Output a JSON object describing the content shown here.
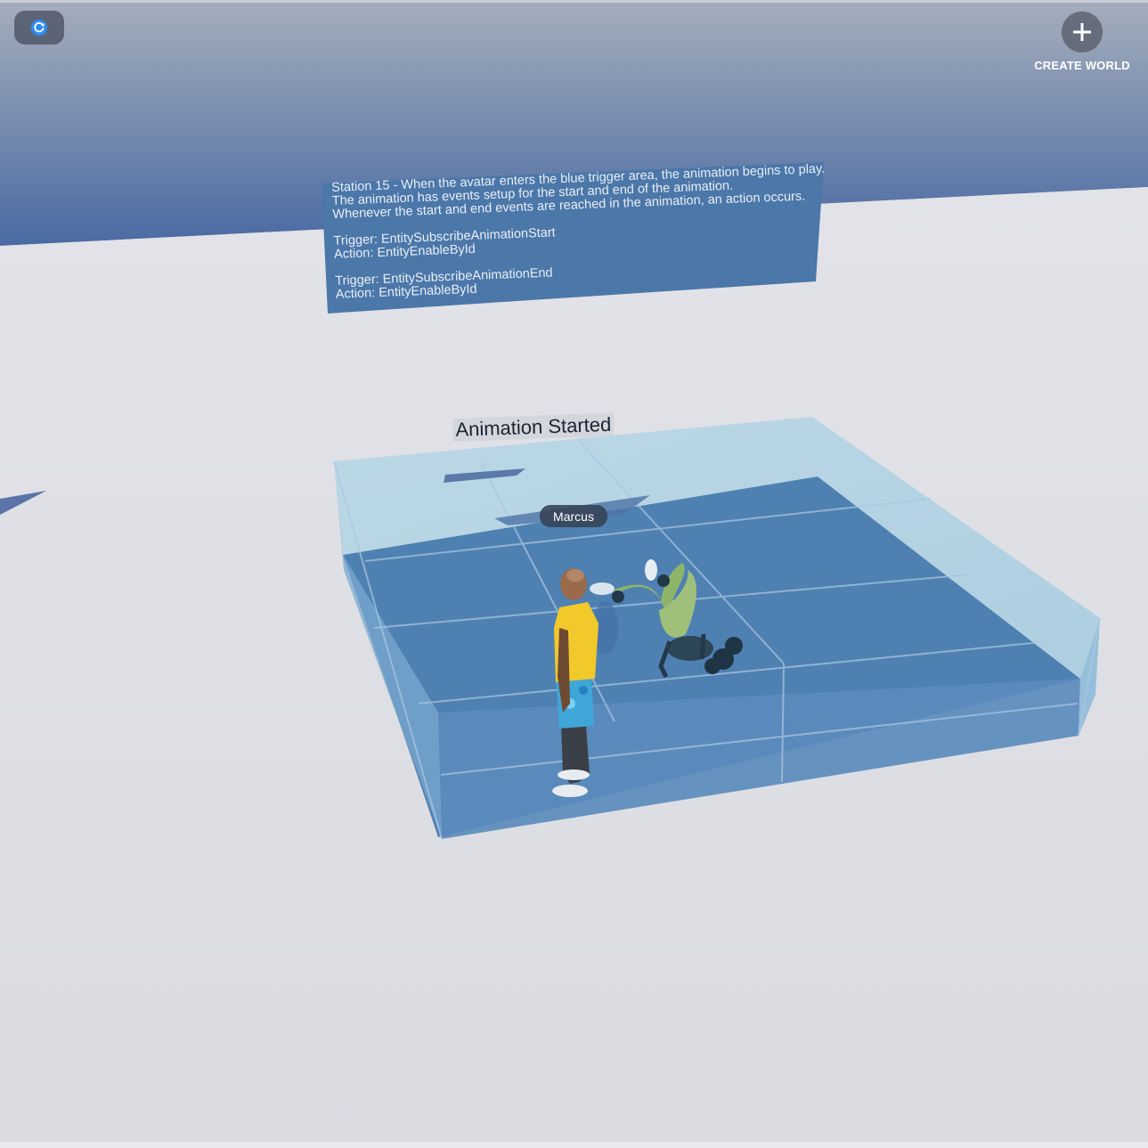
{
  "toolbar": {
    "refresh_icon": "refresh-icon",
    "create_world_label": "CREATE WORLD",
    "create_world_icon": "plus-icon"
  },
  "info_panel": {
    "lines": [
      "Station 15 - When the avatar enters the blue trigger area, the animation begins to play.",
      "The animation has events setup for the start and end of the animation.",
      "Whenever the start and end events are reached in the animation, an action occurs."
    ],
    "block1_trigger": "Trigger: EntitySubscribeAnimationStart",
    "block1_action": "Action: EntityEnableById",
    "block2_trigger": "Trigger: EntitySubscribeAnimationEnd",
    "block2_action": "Action: EntityEnableById"
  },
  "scene": {
    "animation_status": "Animation Started",
    "avatar_name": "Marcus"
  },
  "colors": {
    "sky_top": "#a3acbb",
    "sky_bottom": "#4f6fa5",
    "floor": "#dcdde3",
    "panel_blue": "#4d78a8",
    "trigger_blue": "#5786b8",
    "shirt_yellow": "#f2c92a",
    "creature_green": "#8eb46a",
    "accent_blue": "#2d8cf0"
  }
}
